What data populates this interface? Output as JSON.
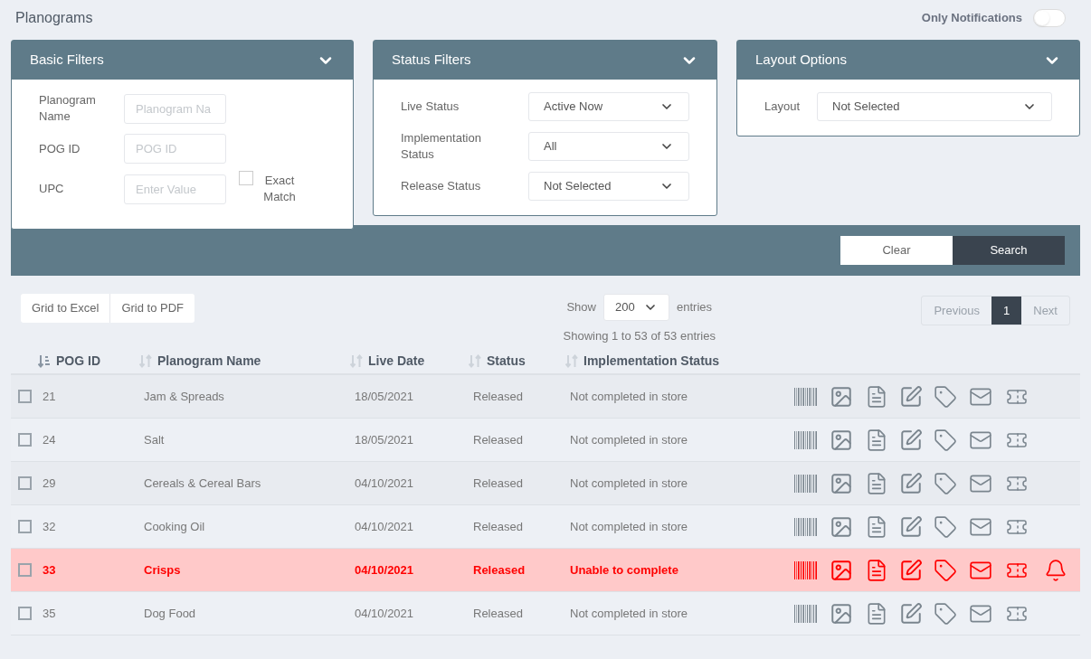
{
  "title": "Planograms",
  "only_notifications": {
    "label": "Only Notifications",
    "on": false
  },
  "basic_filters": {
    "title": "Basic Filters",
    "fields": [
      {
        "label": "Planogram Name",
        "placeholder": "Planogram Na"
      },
      {
        "label": "POG ID",
        "placeholder": "POG ID"
      },
      {
        "label": "UPC",
        "placeholder": "Enter Value",
        "checkbox": {
          "label": "Exact Match",
          "checked": false
        }
      }
    ]
  },
  "status_filters": {
    "title": "Status Filters",
    "fields": [
      {
        "label": "Live Status",
        "value": "Active Now"
      },
      {
        "label": "Implementation Status",
        "value": "All"
      },
      {
        "label": "Release Status",
        "value": "Not Selected"
      }
    ]
  },
  "layout_options": {
    "title": "Layout Options",
    "fields": [
      {
        "label": "Layout",
        "value": "Not Selected"
      }
    ]
  },
  "search_bar": {
    "buttons": [
      {
        "label": "Clear",
        "kind": "secondary"
      },
      {
        "label": "Search",
        "kind": "primary"
      }
    ]
  },
  "export_buttons": [
    "Grid to Excel",
    "Grid to PDF"
  ],
  "show_entries": {
    "before": "Show",
    "value": "200",
    "after": "entries"
  },
  "info": "Showing 1 to 53 of 53 entries",
  "pagination": [
    {
      "label": "Previous",
      "selected": false,
      "disabled": true
    },
    {
      "label": "1",
      "selected": true,
      "disabled": false
    },
    {
      "label": "Next",
      "selected": false,
      "disabled": true
    }
  ],
  "table": {
    "columns": [
      {
        "label": "POG ID",
        "sorted": true
      },
      {
        "label": "Planogram Name",
        "sorted": false
      },
      {
        "label": "Live Date",
        "sorted": false
      },
      {
        "label": "Status",
        "sorted": false
      },
      {
        "label": "Implementation Status",
        "sorted": false
      }
    ],
    "rows": [
      {
        "checked": false,
        "flagged": false,
        "cells": [
          "21",
          "Jam & Spreads",
          "18/05/2021",
          "Released",
          "Not completed in store"
        ]
      },
      {
        "checked": false,
        "flagged": false,
        "cells": [
          "24",
          "Salt",
          "18/05/2021",
          "Released",
          "Not completed in store"
        ]
      },
      {
        "checked": false,
        "flagged": false,
        "cells": [
          "29",
          "Cereals & Cereal Bars",
          "04/10/2021",
          "Released",
          "Not completed in store"
        ]
      },
      {
        "checked": false,
        "flagged": false,
        "cells": [
          "32",
          "Cooking Oil",
          "04/10/2021",
          "Released",
          "Not completed in store"
        ]
      },
      {
        "checked": false,
        "flagged": true,
        "cells": [
          "33",
          "Crisps",
          "04/10/2021",
          "Released",
          "Unable to complete"
        ]
      },
      {
        "checked": false,
        "flagged": false,
        "cells": [
          "35",
          "Dog Food",
          "04/10/2021",
          "Released",
          "Not completed in store"
        ]
      }
    ]
  }
}
